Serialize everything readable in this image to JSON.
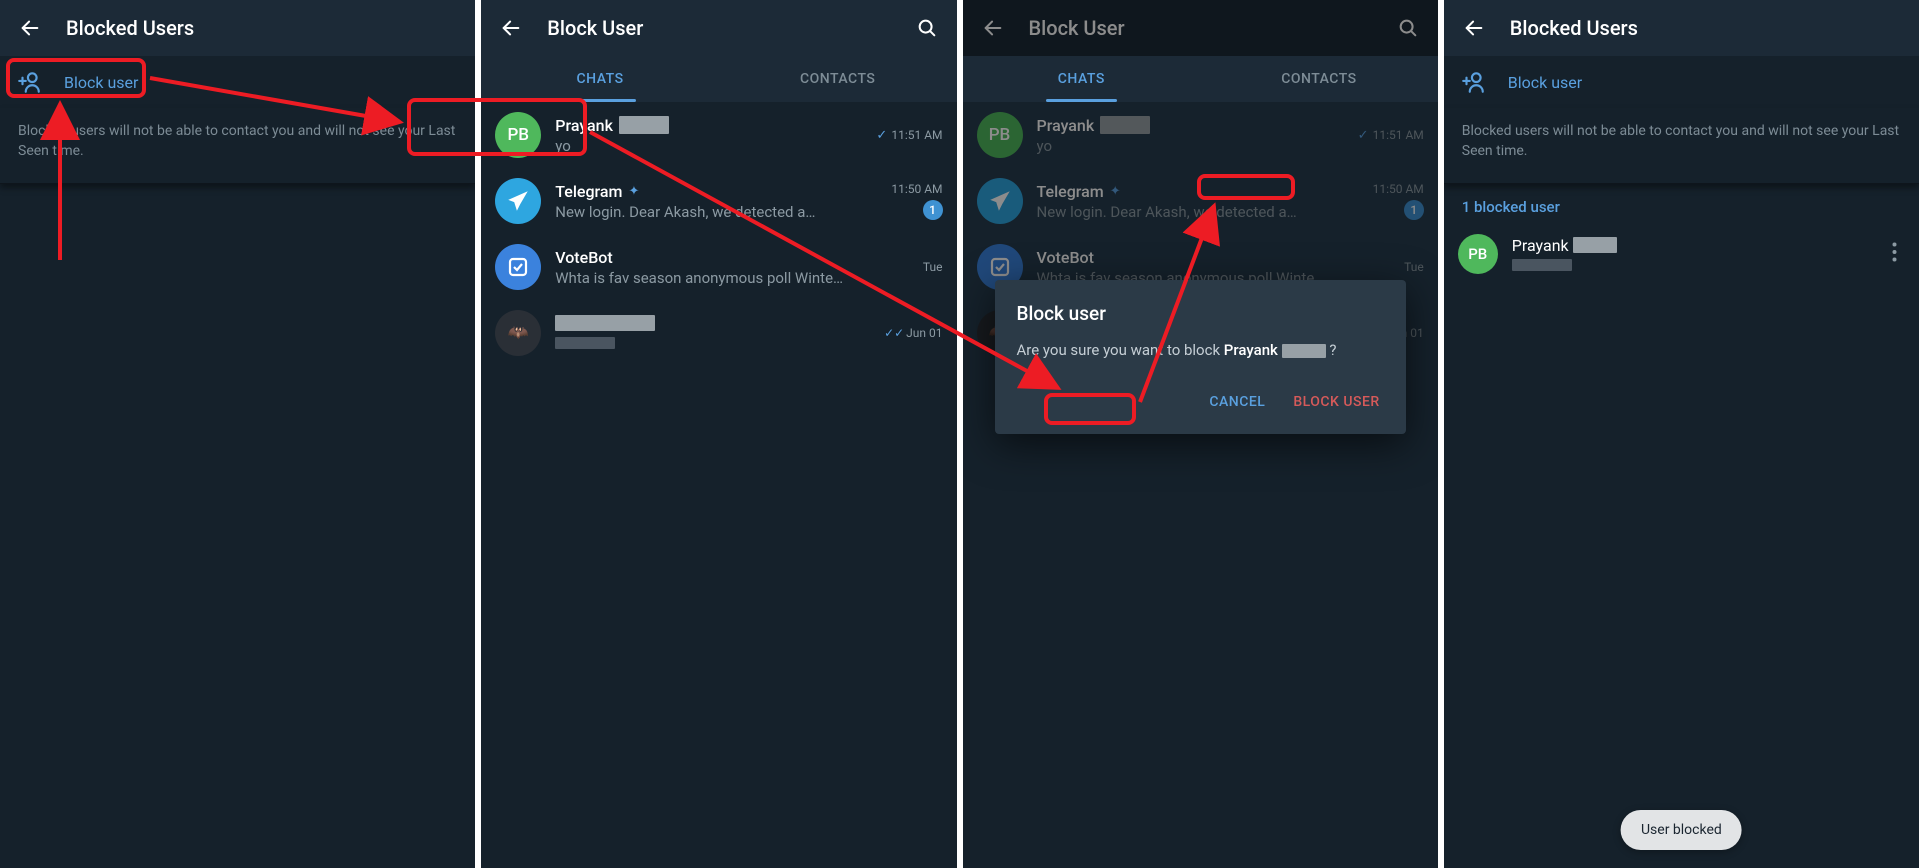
{
  "panel1": {
    "title": "Blocked Users",
    "block_user_label": "Block user",
    "info": "Blocked users will not be able to contact you and will not see your Last Seen time."
  },
  "panel2": {
    "title": "Block User",
    "tabs": {
      "chats": "CHATS",
      "contacts": "CONTACTS"
    },
    "chats": [
      {
        "avatar_text": "PB",
        "name": "Prayank",
        "preview": "yo",
        "time": "11:51 AM",
        "check": true
      },
      {
        "avatar_text": "✈",
        "name": "Telegram",
        "verified": true,
        "preview": "New login. Dear Akash, we detected a…",
        "time": "11:50 AM",
        "badge": "1"
      },
      {
        "avatar_text": "☑",
        "name": "VoteBot",
        "preview": "Whta is fav season anonymous poll  Winte…",
        "time": "Tue"
      },
      {
        "avatar_text": "🦇",
        "name": "",
        "preview": "",
        "time": "Jun 01",
        "double_check": true
      }
    ]
  },
  "panel3": {
    "title": "Block User",
    "tabs": {
      "chats": "CHATS",
      "contacts": "CONTACTS"
    },
    "dialog": {
      "title": "Block user",
      "message_pre": "Are you sure you want to block ",
      "message_name": "Prayank",
      "message_suf": "?",
      "cancel": "CANCEL",
      "confirm": "BLOCK USER"
    }
  },
  "panel4": {
    "title": "Blocked Users",
    "block_user_label": "Block user",
    "info": "Blocked users will not be able to contact you and will not see your Last Seen time.",
    "section": "1 blocked user",
    "blocked": [
      {
        "avatar_text": "PB",
        "name": "Prayank"
      }
    ],
    "toast": "User blocked"
  }
}
